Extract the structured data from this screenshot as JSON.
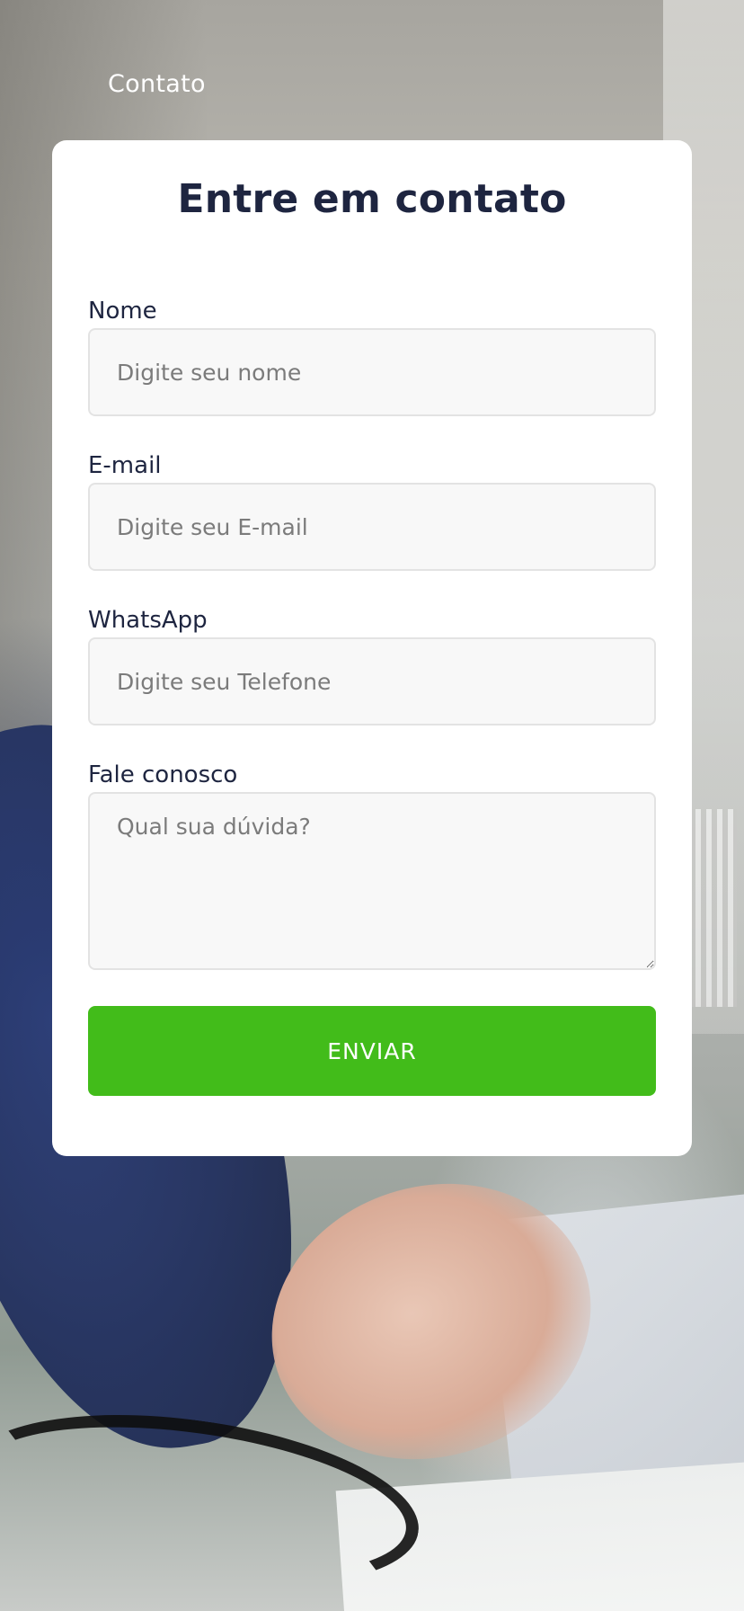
{
  "header": {
    "title": "Contato"
  },
  "contact_form": {
    "title": "Entre em contato",
    "fields": {
      "name": {
        "label": "Nome",
        "placeholder": "Digite seu nome",
        "value": ""
      },
      "email": {
        "label": "E-mail",
        "placeholder": "Digite seu E-mail",
        "value": ""
      },
      "whatsapp": {
        "label": "WhatsApp",
        "placeholder": "Digite seu Telefone",
        "value": ""
      },
      "message": {
        "label": "Fale conosco",
        "placeholder": "Qual sua dúvida?",
        "value": ""
      }
    },
    "submit_label": "ENVIAR"
  },
  "colors": {
    "accent": "#42bc1a",
    "title_text": "#1e2540",
    "card_background": "#ffffff",
    "input_background": "#f8f8f8"
  }
}
